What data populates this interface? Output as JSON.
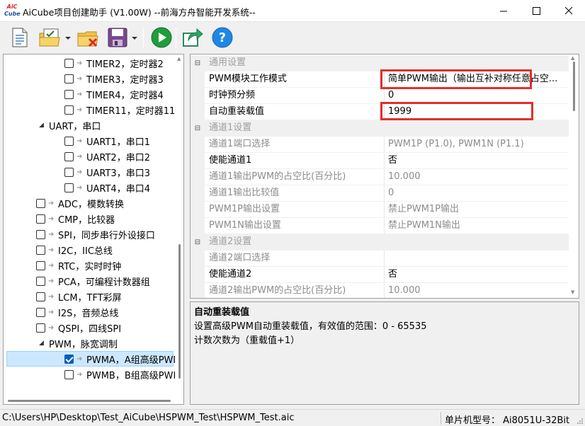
{
  "window": {
    "title": "AiCube项目创建助手 (V1.00W) --前海方舟智能开发系统--",
    "logo_text": "AiC Cube"
  },
  "toolbar": {
    "buttons": [
      {
        "name": "new-file-icon"
      },
      {
        "name": "open-project-icon"
      },
      {
        "name": "close-project-icon"
      },
      {
        "name": "save-icon"
      },
      {
        "name": "run-icon"
      },
      {
        "name": "export-icon"
      },
      {
        "name": "help-icon"
      }
    ]
  },
  "tree": {
    "items": [
      {
        "label": "TIMER2，定时器2",
        "checked": false
      },
      {
        "label": "TIMER3，定时器3",
        "checked": false
      },
      {
        "label": "TIMER4，定时器4",
        "checked": false
      },
      {
        "label": "TIMER11，定时器11",
        "checked": false
      },
      {
        "label": "UART，串口",
        "group": true
      },
      {
        "label": "UART1，串口1",
        "checked": false
      },
      {
        "label": "UART2，串口2",
        "checked": false
      },
      {
        "label": "UART3，串口3",
        "checked": false
      },
      {
        "label": "UART4，串口4",
        "checked": false
      },
      {
        "label": "ADC，模数转换",
        "checked": false
      },
      {
        "label": "CMP，比较器",
        "checked": false
      },
      {
        "label": "SPI，同步串行外设接口",
        "checked": false
      },
      {
        "label": "I2C，IIC总线",
        "checked": false
      },
      {
        "label": "RTC，实时时钟",
        "checked": false
      },
      {
        "label": "PCA，可编程计数器组",
        "checked": false
      },
      {
        "label": "LCM，TFT彩屏",
        "checked": false
      },
      {
        "label": "I2S，音频总线",
        "checked": false
      },
      {
        "label": "QSPI，四线SPI",
        "checked": false
      },
      {
        "label": "PWM，脉宽调制",
        "group": true
      },
      {
        "label": "PWMA，A组高级PWM",
        "checked": true,
        "selected": true
      },
      {
        "label": "PWMB，B组高级PWM",
        "checked": false
      }
    ]
  },
  "properties": {
    "rows": [
      {
        "category": true,
        "name": "通用设置"
      },
      {
        "name": "PWM模块工作模式",
        "value": "简单PWM输出（输出互补对称任意占空..."
      },
      {
        "name": "时钟预分频",
        "value": "0"
      },
      {
        "name": "自动重装载值",
        "value": "1999"
      },
      {
        "category": true,
        "name": "通道1设置"
      },
      {
        "name": "通道1端口选择",
        "value": "PWM1P (P1.0), PWM1N (P1.1)",
        "disabled": true
      },
      {
        "name": "使能通道1",
        "value": "否"
      },
      {
        "name": "通道1输出PWM的占空比(百分比)",
        "value": "10.000",
        "disabled": true
      },
      {
        "name": "通道1输出比较值",
        "value": "0",
        "disabled": true
      },
      {
        "name": "PWM1P输出设置",
        "value": "禁止PWM1P输出",
        "disabled": true
      },
      {
        "name": "PWM1N输出设置",
        "value": "禁止PWM1N输出",
        "disabled": true
      },
      {
        "category": true,
        "name": "通道2设置"
      },
      {
        "name": "通道2端口选择",
        "value": "",
        "disabled": true
      },
      {
        "name": "使能通道2",
        "value": "否"
      },
      {
        "name": "通道2输出PWM的占空比(百分比)",
        "value": "10.000",
        "disabled": true
      }
    ]
  },
  "description": {
    "title": "自动重装载值",
    "lines": [
      "设置高级PWM自动重装载值，有效值的范围：0 - 65535",
      "计数次数为（重载值+1）"
    ]
  },
  "status": {
    "path": "C:\\Users\\HP\\Desktop\\Test_AiCube\\HSPWM_Test\\HSPWM_Test.aic",
    "model": "单片机型号：  Ai8051U-32Bit"
  },
  "colors": {
    "highlight_box": "#e0302a",
    "selection": "#cce8ff"
  }
}
